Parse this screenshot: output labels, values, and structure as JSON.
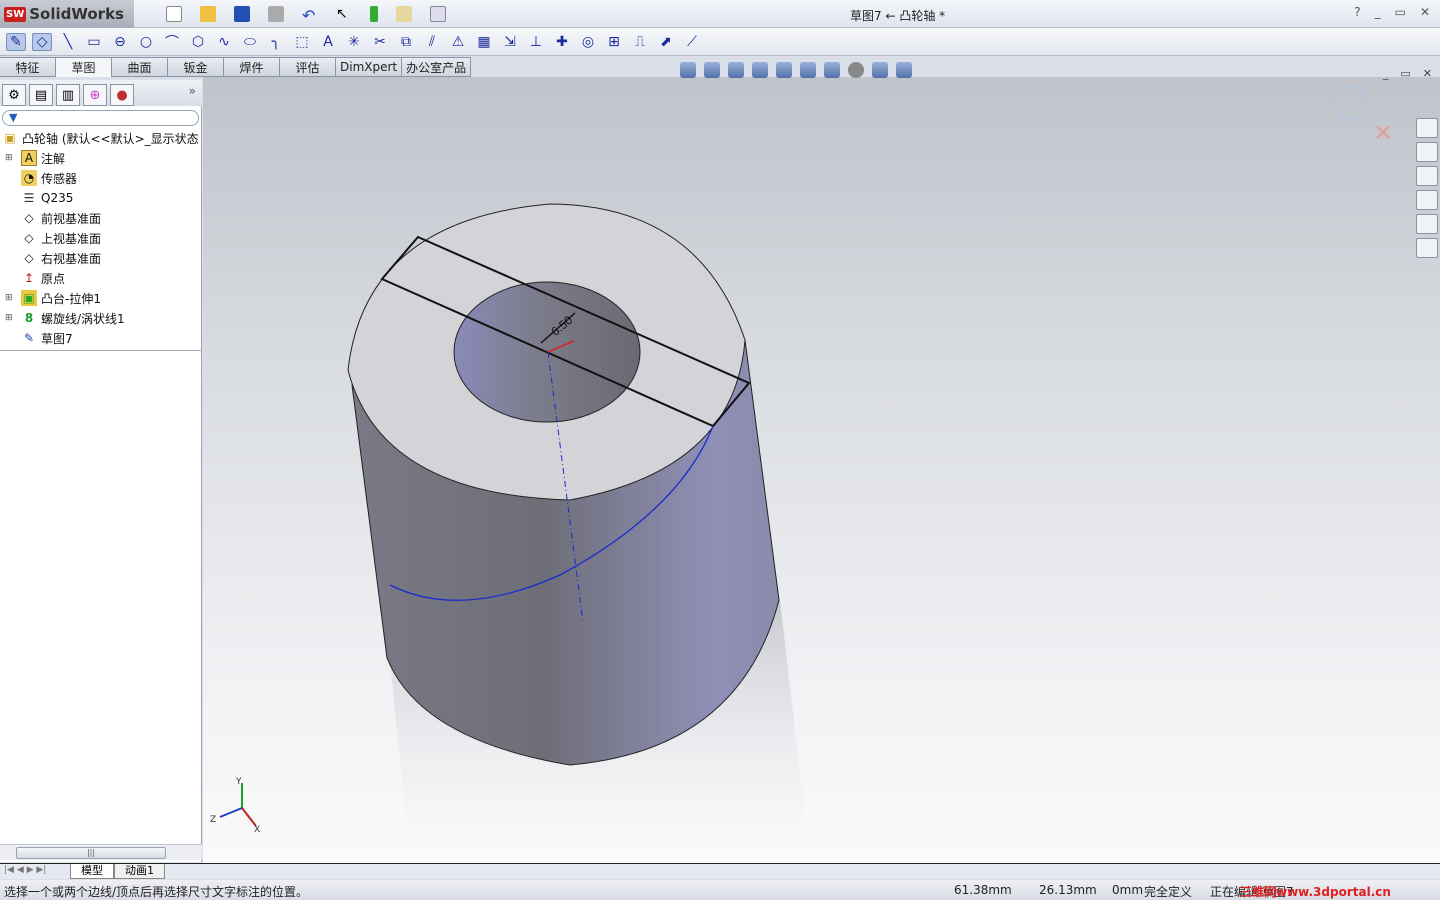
{
  "app": {
    "name": "SolidWorks",
    "title": "草图7 ← 凸轮轴 *"
  },
  "window_buttons": [
    "?",
    "_",
    "▭",
    "✕"
  ],
  "command_tabs": [
    {
      "label": "特征"
    },
    {
      "label": "草图",
      "active": true
    },
    {
      "label": "曲面"
    },
    {
      "label": "钣金"
    },
    {
      "label": "焊件"
    },
    {
      "label": "评估"
    },
    {
      "label": "DimXpert"
    },
    {
      "label": "办公室产品"
    }
  ],
  "feature_tree": {
    "filter_icon": "filter-icon",
    "root": "凸轮轴 (默认<<默认>_显示状态",
    "items": [
      {
        "label": "注解",
        "icon": "annotation-icon",
        "expandable": true
      },
      {
        "label": "传感器",
        "icon": "sensor-icon",
        "expandable": false
      },
      {
        "label": "Q235",
        "icon": "material-icon",
        "expandable": false
      },
      {
        "label": "前视基准面",
        "icon": "plane-icon",
        "expandable": false
      },
      {
        "label": "上视基准面",
        "icon": "plane-icon",
        "expandable": false
      },
      {
        "label": "右视基准面",
        "icon": "plane-icon",
        "expandable": false
      },
      {
        "label": "原点",
        "icon": "origin-icon",
        "expandable": false
      },
      {
        "label": "凸台-拉伸1",
        "icon": "extrude-icon",
        "expandable": true
      },
      {
        "label": "螺旋线/涡状线1",
        "icon": "helix-icon",
        "expandable": true
      },
      {
        "label": "草图7",
        "icon": "sketch-icon",
        "expandable": false
      }
    ]
  },
  "viewport": {
    "dimension_label": "6.50",
    "axes": {
      "x": "X",
      "y": "Y",
      "z": "Z"
    }
  },
  "bottom_tabs": [
    "模型",
    "动画1"
  ],
  "status": {
    "message": "选择一个或两个边线/顶点后再选择尺寸文字标注的位置。",
    "x": "61.38mm",
    "y": "26.13mm",
    "z": "0mm",
    "state": "完全定义",
    "mode": "正在编辑 草图7",
    "watermark": "三维网www.3dportal.cn"
  },
  "colors": {
    "accent": "#1a2a9a",
    "helix": "#1a2ad0",
    "cylinder": "#8c8ca8"
  }
}
